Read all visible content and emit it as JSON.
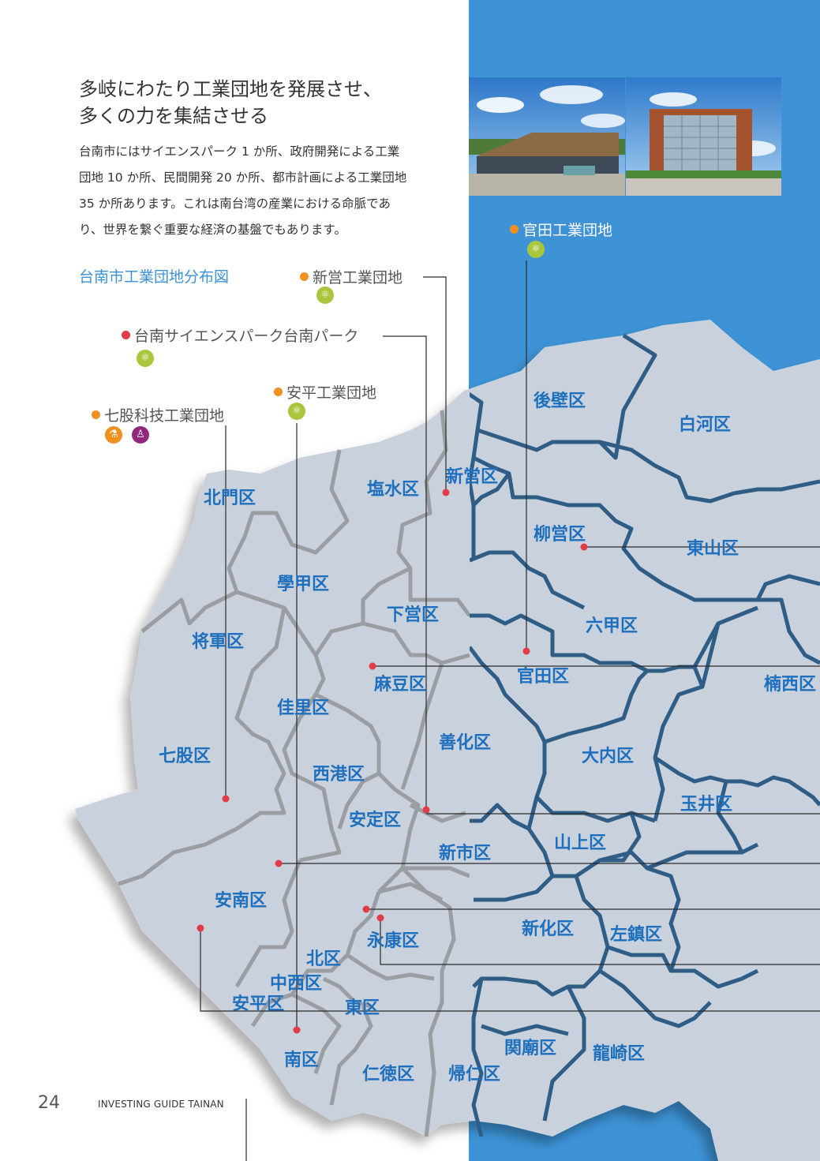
{
  "headline": [
    "多岐にわたり工業団地を発展させ、",
    "多くの力を集結させる"
  ],
  "intro_lines": [
    "台南市にはサイエンスパーク 1 か所、政府開発による工業",
    "団地 10 か所、民間開発 20 か所、都市計画による工業団地",
    "35 か所あります。これは南台湾の産業における命脈であ",
    "り、世界を繋ぐ重要な経済の基盤でもあります。"
  ],
  "map_title": "台南市工業団地分布図",
  "callouts": {
    "guantian": "官田工業団地",
    "xinying": "新営工業団地",
    "tainan_park": "台南サイエンスパーク台南パーク",
    "anping": "安平工業団地",
    "qigu": "七股科技工業団地"
  },
  "icons": {
    "green": "atom-icon",
    "orange": "flask-icon",
    "purple": "person-icon"
  },
  "districts": {
    "houbi": "後壁区",
    "baihe": "白河区",
    "xinying": "新営区",
    "yanshui": "塩水区",
    "beimen": "北門区",
    "liuying": "柳営区",
    "dongshan": "東山区",
    "xuejia": "學甲区",
    "xiaying": "下営区",
    "liujia": "六甲区",
    "jiangjun": "将軍区",
    "madou": "麻豆区",
    "guantian": "官田区",
    "nanxi": "楠西区",
    "jiali": "佳里区",
    "shanhua": "善化区",
    "qigu": "七股区",
    "danei": "大内区",
    "xigang": "西港区",
    "yujing": "玉井区",
    "anding": "安定区",
    "shanshang": "山上区",
    "xinshi": "新市区",
    "annan": "安南区",
    "xinhua": "新化区",
    "zuozhen": "左鎮区",
    "yongkang": "永康区",
    "north": "北区",
    "westcentral": "中西区",
    "anping": "安平区",
    "east": "東区",
    "south": "南区",
    "guanmiao": "関廟区",
    "longqi": "龍崎区",
    "rende": "仁徳区",
    "guiren": "帰仁区"
  },
  "colors": {
    "blue_panel": "#3d93d6",
    "map_fill": "#c9d2dc",
    "border_blue": "#2f5d86",
    "border_gray": "#9a9da1",
    "district_text": "#1e6fbd",
    "marker_red": "#e23c46",
    "marker_orange": "#f0901e"
  },
  "footer": {
    "page_number": "24",
    "guide_title": "INVESTING GUIDE TAINAN"
  }
}
